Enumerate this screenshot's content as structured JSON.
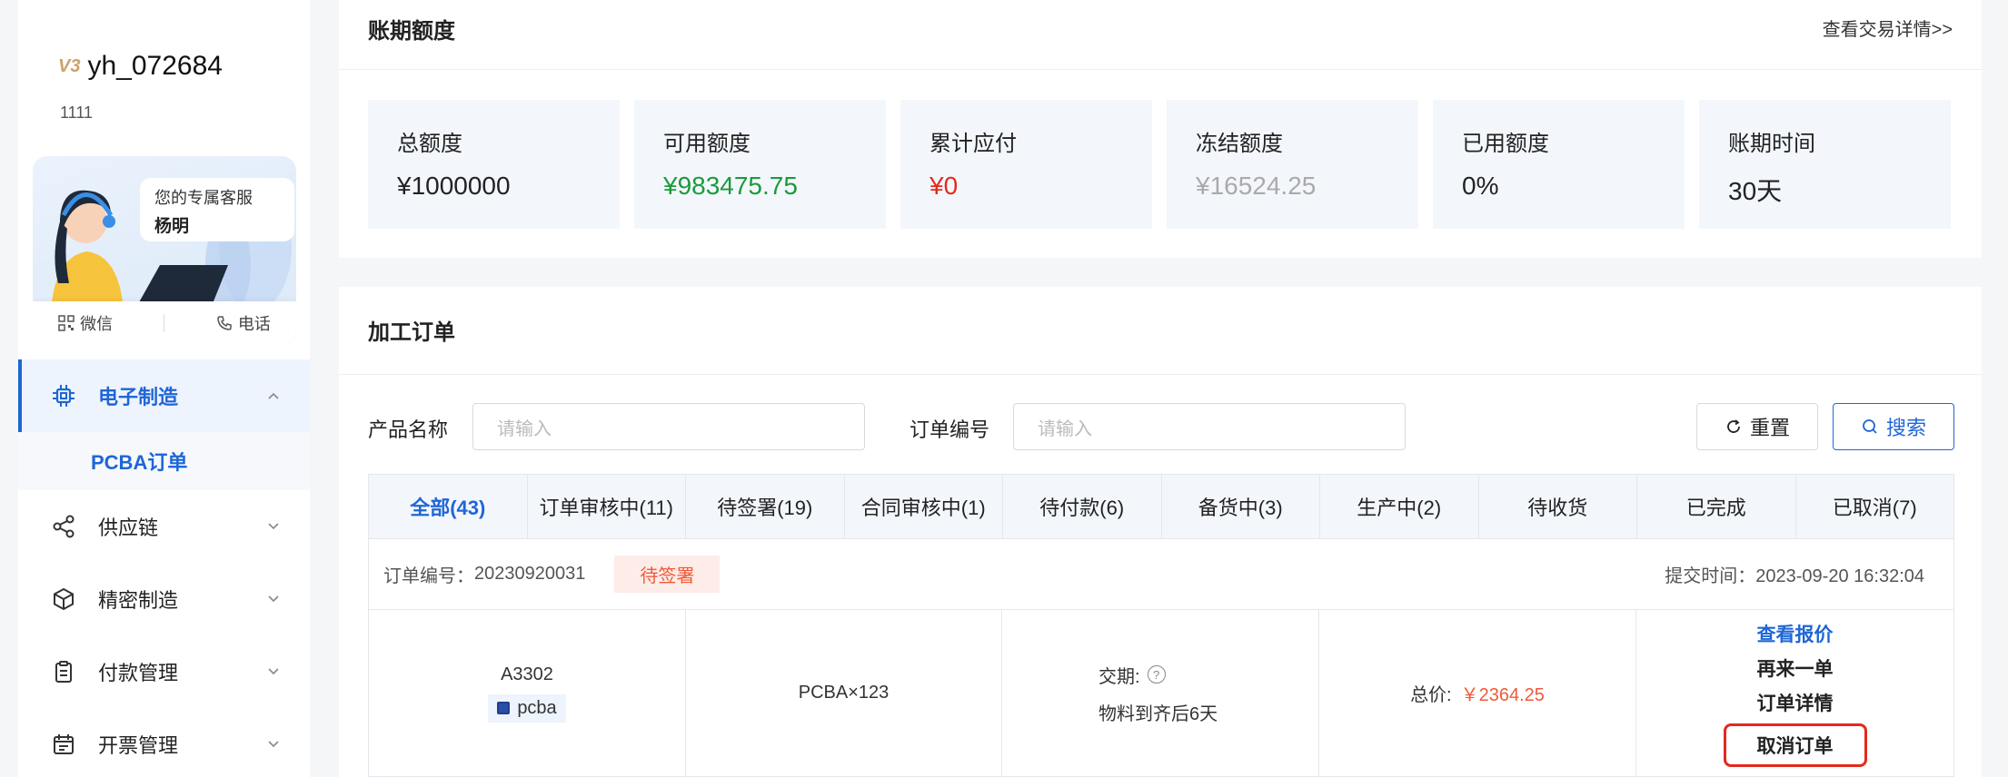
{
  "user": {
    "badge": "V3",
    "name": "yh_072684",
    "sub": "1111"
  },
  "service": {
    "title": "您的专属客服",
    "name": "杨明",
    "wechat": "微信",
    "phone": "电话"
  },
  "menu": {
    "items": [
      {
        "label": "电子制造"
      },
      {
        "label": "供应链"
      },
      {
        "label": "精密制造"
      },
      {
        "label": "付款管理"
      },
      {
        "label": "开票管理"
      }
    ],
    "sub_item": "PCBA订单"
  },
  "credit": {
    "title": "账期额度",
    "link": "查看交易详情>>",
    "stats": [
      {
        "label": "总额度",
        "value": "¥1000000",
        "color": "#222222"
      },
      {
        "label": "可用额度",
        "value": "¥983475.75",
        "color": "#1a9b3a"
      },
      {
        "label": "累计应付",
        "value": "¥0",
        "color": "#e5291c"
      },
      {
        "label": "冻结额度",
        "value": "¥16524.25",
        "color": "#aaaaaa"
      },
      {
        "label": "已用额度",
        "value": "0%",
        "color": "#222222"
      },
      {
        "label": "账期时间",
        "value": "30天",
        "color": "#222222"
      }
    ]
  },
  "orders": {
    "title": "加工订单",
    "filters": {
      "product_label": "产品名称",
      "product_placeholder": "请输入",
      "order_label": "订单编号",
      "order_placeholder": "请输入",
      "reset": "重置",
      "search": "搜索"
    },
    "tabs": [
      "全部(43)",
      "订单审核中(11)",
      "待签署(19)",
      "合同审核中(1)",
      "待付款(6)",
      "备货中(3)",
      "生产中(2)",
      "待收货",
      "已完成",
      "已取消(7)"
    ],
    "order": {
      "number_label": "订单编号：",
      "number": "20230920031",
      "status": "待签署",
      "time_label": "提交时间：",
      "time": "2023-09-20 16:32:04",
      "product_code": "A3302",
      "product_tag": "pcba",
      "quantity": "PCBA×123",
      "delivery_label": "交期:",
      "delivery_value": "物料到齐后6天",
      "price_label": "总价:",
      "price": "￥2364.25",
      "actions": [
        "查看报价",
        "再来一单",
        "订单详情",
        "取消订单"
      ]
    }
  }
}
